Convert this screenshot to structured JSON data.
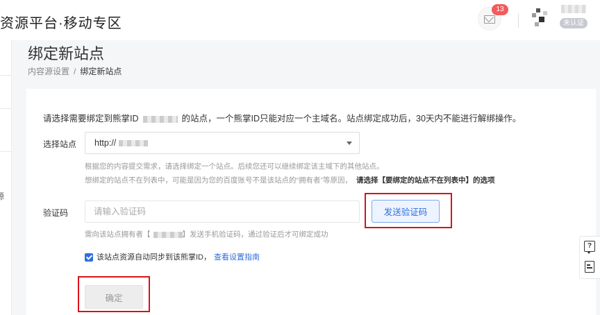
{
  "header": {
    "brand": "资源平台·移动专区",
    "message_badge": "13",
    "verify_tag": "未认证"
  },
  "page": {
    "title": "绑定新站点",
    "breadcrumb_parent": "内容源设置",
    "breadcrumb_sep": "/",
    "breadcrumb_current": "绑定新站点"
  },
  "sidebar": {
    "partial_char": "源"
  },
  "form": {
    "intro_prefix": "请选择需要绑定到熊掌ID",
    "intro_suffix": "的站点，一个熊掌ID只能对应一个主域名。站点绑定成功后，30天内不能进行解绑操作。",
    "site_label": "选择站点",
    "site_value": "http://",
    "site_hint1": "根据您的内容提交需求，请选择绑定一个站点。后续您还可以继续绑定该主域下的其他站点。",
    "site_hint2": "想绑定的站点不在列表中，可能是因为您的百度账号不是该站点的“拥有者”等原因，",
    "site_hint2_strong": "请选择【要绑定的站点不在列表中】的选项",
    "code_label": "验证码",
    "code_placeholder": "请输入验证码",
    "send_code_label": "发送验证码",
    "code_hint_prefix": "需向该站点拥有者【",
    "code_hint_suffix": "】发送手机验证码，通过验证后才可绑定成功",
    "sync_label": "该站点资源自动同步到该熊掌ID，",
    "sync_link": "查看设置指南",
    "confirm_label": "确定"
  },
  "float_bar": {
    "help_glyph": "?"
  },
  "colors": {
    "accent": "#2f6fdd",
    "highlight": "#d9111a",
    "badge": "#f25b5b"
  }
}
